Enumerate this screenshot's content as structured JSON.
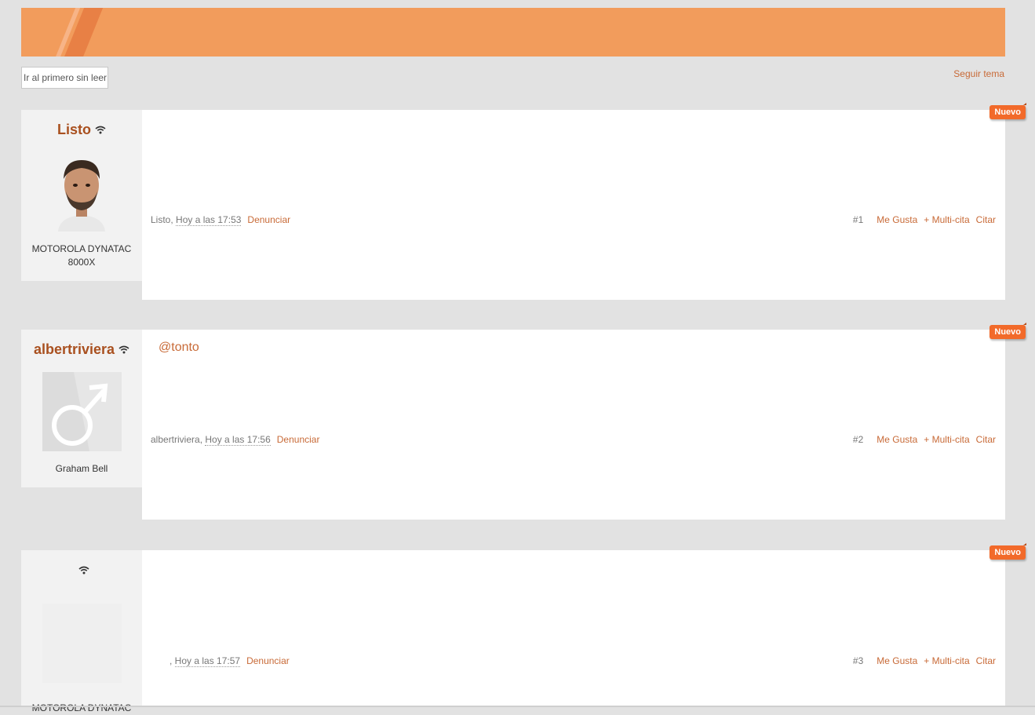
{
  "toolbar": {
    "unread_button": "Ir al primero sin leer",
    "follow_link": "Seguir tema"
  },
  "colors": {
    "banner": "#f29c5c",
    "accent": "#c86a37",
    "badge": "#f26a2a"
  },
  "posts": [
    {
      "username": "Listo",
      "status_icon": "wifi-icon",
      "avatar": "user-photo",
      "user_title": "MOTOROLA DYNATAC 8000X",
      "mention": "",
      "author": "Listo",
      "date": "Hoy a las 17:53",
      "report": "Denunciar",
      "number": "#1",
      "like": "Me Gusta",
      "multiquote": "+ Multi-cita",
      "quote": "Citar",
      "badge": "Nuevo"
    },
    {
      "username": "albertriviera",
      "status_icon": "wifi-icon",
      "avatar": "male-symbol-placeholder",
      "user_title": "Graham Bell",
      "mention": "@tonto",
      "author": "albertriviera",
      "date": "Hoy a las 17:56",
      "report": "Denunciar",
      "number": "#2",
      "like": "Me Gusta",
      "multiquote": "+ Multi-cita",
      "quote": "Citar",
      "badge": "Nuevo"
    },
    {
      "username": "",
      "status_icon": "wifi-icon",
      "avatar": "blank-avatar",
      "user_title": "MOTOROLA DYNATAC",
      "mention": "",
      "author": "",
      "date": "Hoy a las 17:57",
      "report": "Denunciar",
      "number": "#3",
      "like": "Me Gusta",
      "multiquote": "+ Multi-cita",
      "quote": "Citar",
      "badge": "Nuevo"
    }
  ]
}
